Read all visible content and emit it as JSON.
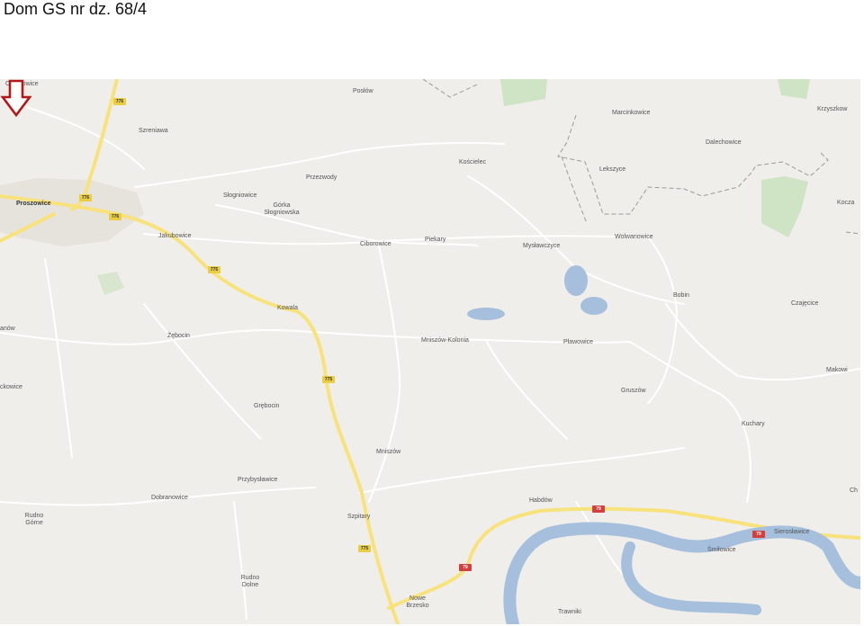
{
  "title": "Dom GS nr dz. 68/4",
  "colors": {
    "land": "#f0eeea",
    "water": "#a5bfdd",
    "road_major": "#f7e27b",
    "road_minor": "#ffffff",
    "forest": "#cfe3c5",
    "marker": "#b21a1a",
    "border": "#9a9a9a"
  },
  "marker": {
    "name": "arrow-down-icon",
    "points_to": "Bobin"
  },
  "labels": {
    "opatkowice": "Opatkowice",
    "poslow": "Posłów",
    "marcinkowice": "Marcinkowice",
    "krzyszkow": "Krzyszkow",
    "szreniawa": "Szreniawa",
    "dalechowice": "Dalechowice",
    "koscielec": "Kościelec",
    "przezwody": "Przezwody",
    "lekszyce": "Lekszyce",
    "slogniowice": "Słogniowice",
    "gorka": "Górka Słogniowska",
    "proszowice": "Proszowice",
    "kocza": "Kocza",
    "jakubowice": "Jakubowice",
    "ciborowice": "Ciborowice",
    "piekary": "Piekary",
    "myslawczyce": "Mysławczyce",
    "wolwanowice": "Wolwanowice",
    "bobin": "Bobin",
    "czajecice": "Czajęcice",
    "nw": "anów",
    "kowala": "Kowala",
    "zebocin": "Żębocin",
    "mniszow_kolonia": "Mniszów-Kolonia",
    "plawowice": "Pławowice",
    "makowi": "Makowi",
    "ckowice": "ckowice",
    "gruszow": "Gruszów",
    "grebocin": "Grębocin",
    "kuchary": "Kuchary",
    "mniszow": "Mniszów",
    "przybyslawice": "Przybysławice",
    "ch": "Ch",
    "dobranowice": "Dobranowice",
    "habdow": "Habdów",
    "rudno_gorne": "Rudno Górne",
    "szpitary": "Szpitary",
    "sieroslawice": "Sierosławice",
    "smilowice": "Śmiłowice",
    "rudno_dolne": "Rudno Dolne",
    "nowe_brzesko": "Nowe Brzesko",
    "trawniki": "Trawniki"
  },
  "road_numbers": {
    "r776": "776",
    "r775": "775",
    "r79": "79"
  }
}
